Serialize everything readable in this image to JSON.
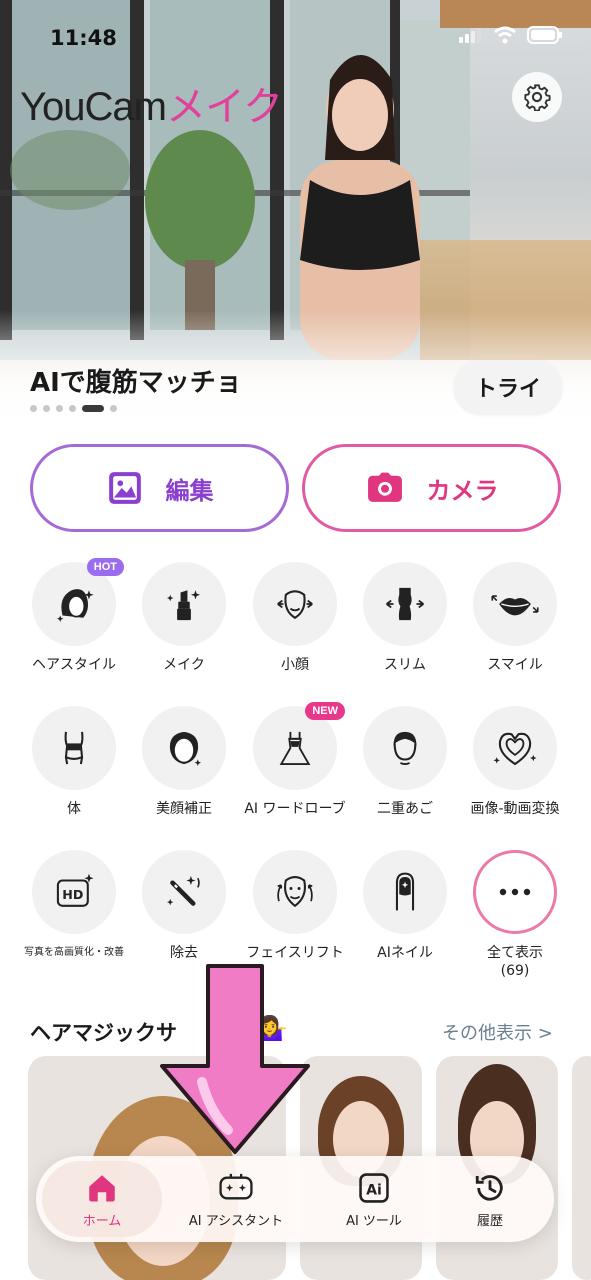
{
  "status": {
    "time": "11:48"
  },
  "header": {
    "logo_main": "YouCam",
    "logo_accent": "メイク"
  },
  "promo": {
    "title": "AIで腹筋マッチョ",
    "try_label": "トライ",
    "page_count": 6,
    "active_page": 5
  },
  "main_actions": {
    "edit_label": "編集",
    "camera_label": "カメラ"
  },
  "features": [
    {
      "label": "ヘアスタイル",
      "icon": "hair-icon",
      "badge": "HOT"
    },
    {
      "label": "メイク",
      "icon": "lipstick-icon"
    },
    {
      "label": "小顔",
      "icon": "face-slim-icon"
    },
    {
      "label": "スリム",
      "icon": "body-slim-icon"
    },
    {
      "label": "スマイル",
      "icon": "smile-lips-icon"
    },
    {
      "label": "体",
      "icon": "body-icon"
    },
    {
      "label": "美顔補正",
      "icon": "beauty-face-icon"
    },
    {
      "label": "AI ワードローブ",
      "icon": "dress-icon",
      "badge": "NEW"
    },
    {
      "label": "二重あご",
      "icon": "double-chin-icon"
    },
    {
      "label": "画像-動画変換",
      "icon": "photo-to-video-icon"
    },
    {
      "label": "写真を高画質化・改善",
      "icon": "hd-icon"
    },
    {
      "label": "除去",
      "icon": "magic-wand-icon"
    },
    {
      "label": "フェイスリフト",
      "icon": "face-lift-icon"
    },
    {
      "label": "AIネイル",
      "icon": "nail-icon"
    },
    {
      "label": "全て表示\n(69)",
      "icon": "more-icon"
    }
  ],
  "section": {
    "title": "ヘアマジックサ",
    "emoji": "💁‍♀️",
    "see_more": "その他表示 >"
  },
  "nav": [
    {
      "label": "ホーム",
      "icon": "home-icon",
      "active": true
    },
    {
      "label": "AI アシスタント",
      "icon": "ai-assistant-icon"
    },
    {
      "label": "AI ツール",
      "icon": "ai-tools-icon"
    },
    {
      "label": "履歴",
      "icon": "history-icon"
    }
  ],
  "colors": {
    "accent_pink": "#e0357f",
    "accent_purple": "#8a3fd0",
    "arrow_pink": "#f07cc6"
  }
}
